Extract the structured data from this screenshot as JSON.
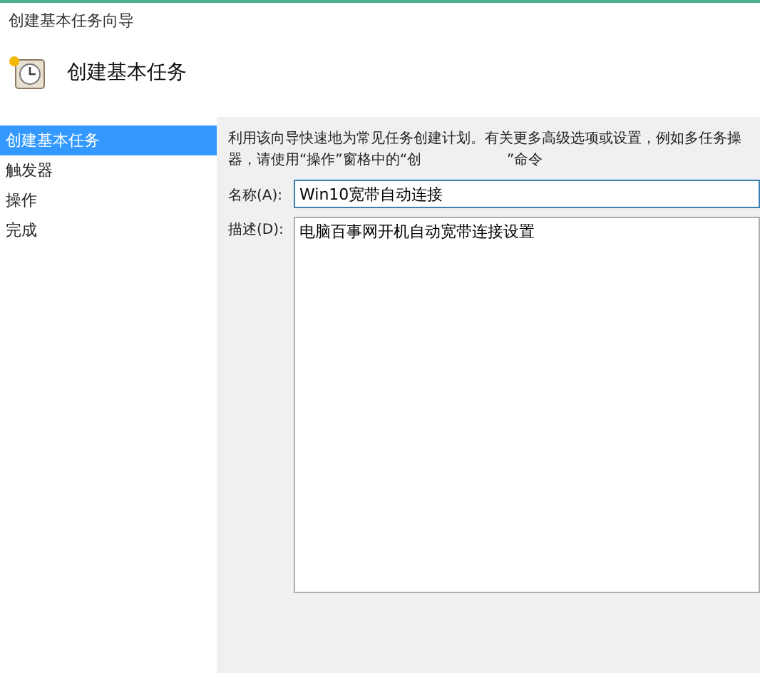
{
  "window": {
    "title": "创建基本任务向导"
  },
  "header": {
    "title": "创建基本任务"
  },
  "sidebar": {
    "items": [
      {
        "label": "创建基本任务",
        "selected": true
      },
      {
        "label": "触发器",
        "selected": false
      },
      {
        "label": "操作",
        "selected": false
      },
      {
        "label": "完成",
        "selected": false
      }
    ]
  },
  "intro": [
    "利用该向导快速地为常见任务创建计划。有关更多高级选项或设置，例如多任务操",
    "器，请使用“操作”窗格中的“创",
    "”命令"
  ],
  "name_field": {
    "label": "名称(A):",
    "value": "Win10宽带自动连接"
  },
  "description_field": {
    "label": "描述(D):",
    "value": "电脑百事网开机自动宽带连接设置"
  }
}
